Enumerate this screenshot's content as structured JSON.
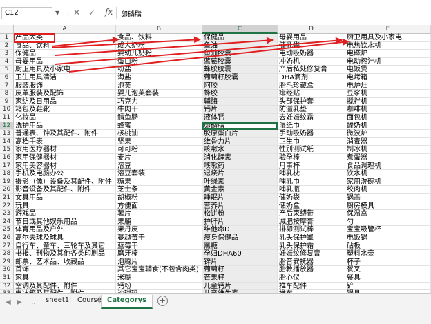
{
  "formula_bar": {
    "name_box": "C12",
    "cancel_icon": "✕",
    "enter_icon": "✓",
    "fx_label": "fx",
    "content": "卵磷脂"
  },
  "columns": [
    "A",
    "B",
    "C",
    "D",
    "E"
  ],
  "rows": [
    [
      "产品大类",
      "食品、饮料",
      "保健品",
      "母婴用品",
      "厨卫用具及小家电"
    ],
    [
      "食品、饮料",
      "成人奶粉",
      "鱼油",
      "储乳袋",
      "电热饮水机"
    ],
    [
      "保健品",
      "婴幼儿奶粉",
      "鱼油胶囊",
      "电动吸奶器",
      "电磁炉"
    ],
    [
      "母婴用品",
      "蛋白粉",
      "蓝莓胶囊",
      "冲奶机",
      "电动榨汁机"
    ],
    [
      "厨卫用具及小家电",
      "粉盐",
      "蜂胶胶囊",
      "产后私处修复膏",
      "电饭煲"
    ],
    [
      "卫生用具清洁",
      "海盐",
      "葡萄籽胶囊",
      "DHA滴剂",
      "电烤箱"
    ],
    [
      "服装服饰",
      "泡芙",
      "阿胶",
      "胎毛珍藏盒",
      "电炉灶"
    ],
    [
      "皮革服装及配饰",
      "婴儿泡芙套装",
      "蜂胶",
      "痱经贴",
      "豆浆机"
    ],
    [
      "家纺及日用品",
      "巧克力",
      "辅酶",
      "头部保护套",
      "搅拌机"
    ],
    [
      "箱包及鞋靴",
      "牛肉干",
      "钙片",
      "防溢乳垫",
      "咖啡机"
    ],
    [
      "化妆品",
      "鳕鱼肠",
      "液体钙",
      "去妊娠纹霜",
      "面包机"
    ],
    [
      "洗护用品",
      "蜂蜜",
      "卵磷脂",
      "湿纸巾",
      "酸奶机"
    ],
    [
      "普通表、钟及其配件、附件",
      "核桃油",
      "胶原蛋白片",
      "手动吸奶器",
      "微波炉"
    ],
    [
      "高档手表",
      "坚果",
      "维骨力片",
      "卫生巾",
      "消毒器"
    ],
    [
      "家用医疗器材",
      "可可粉",
      "咳嗽水",
      "性别测试纸",
      "制冰机"
    ],
    [
      "家用保健器材",
      "麦片",
      "消化酵素",
      "验孕棒",
      "煮蛋器"
    ],
    [
      "家用美容器材",
      "溶豆",
      "咳嗽药",
      "月事杯",
      "食品调理机"
    ],
    [
      "手机及电脑办公",
      "溶豆套装",
      "退烧片",
      "哺乳枕",
      "饮水机"
    ],
    [
      "摄影（像）设备及其配件、附件",
      "糖果",
      "叶绿素",
      "哺乳巾",
      "家用洗碗机"
    ],
    [
      "影音设备及其配件、附件",
      "芝士条",
      "黄金素",
      "哺乳瓶",
      "绞肉机"
    ],
    [
      "文具用品",
      "胡椒粉",
      "睡眠片",
      "储奶袋",
      "锅盖"
    ],
    [
      "玩具",
      "方便面",
      "营养片",
      "储奶盒",
      "厨房模具"
    ],
    [
      "游戏品",
      "薯片",
      "松饼粉",
      "产后束缚带",
      "保温盒"
    ],
    [
      "节日或其他娱乐用品",
      "果脯",
      "护肝片",
      "减肥按摩膏",
      "勺"
    ],
    [
      "体育用品及户外",
      "果丹皮",
      "维他命D",
      "排卵测试棒",
      "宝宝吸管杯"
    ],
    [
      "高尔夫球及球具",
      "蔓越莓干",
      "瘦身保健品",
      "乳头保护罩",
      "电饭锅"
    ],
    [
      "自行车、童车、三轮车及其它",
      "蓝莓干",
      "黑糖",
      "乳头保护霜",
      "砧板"
    ],
    [
      "书报、刊物及其他各类印刷品",
      "磨牙棒",
      "孕妇DHA60",
      "妊娠纹修复膏",
      "塑料水壶"
    ],
    [
      "邮票、艺术品、收藏品",
      "泡腾片",
      "锌片",
      "胎音安抚器",
      "杯子"
    ],
    [
      "首饰",
      "其它宝宝辅食(不包含肉类)",
      "葡萄籽",
      "胎教播放器",
      "餐叉"
    ],
    [
      "家具",
      "米糊",
      "芒果籽",
      "胎心仪",
      "餐具"
    ],
    [
      "空调及其配件、附件",
      "钙粉",
      "儿童钙片",
      "推车配件",
      "铲"
    ],
    [
      "电冰箱及其配件、附件",
      "沙琪玛",
      "儿童维生素",
      "推车",
      "锅具"
    ]
  ],
  "active_cell": {
    "row": 12,
    "col": "C"
  },
  "sheet_tabs": [
    {
      "label": "sheet1",
      "active": false
    },
    {
      "label": "Course",
      "active": false
    },
    {
      "label": "Categorys",
      "active": true
    }
  ],
  "nav": {
    "prev_icon": "◀",
    "next_icon": "▶",
    "more_icon": "...",
    "add_icon": "+"
  },
  "colors": {
    "accent": "#217346",
    "annotation": "#e02020",
    "selected_column": "#ececec"
  }
}
